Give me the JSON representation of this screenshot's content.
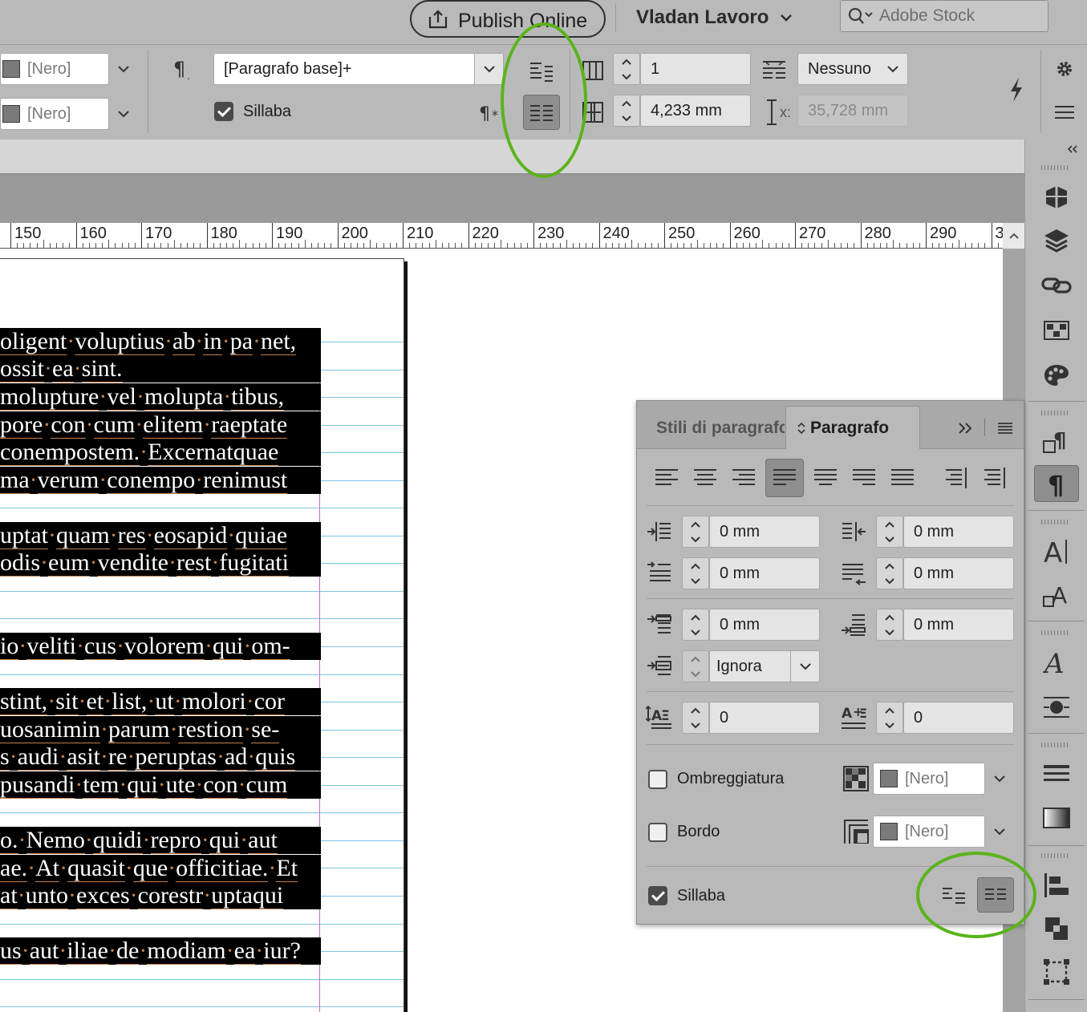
{
  "topbar": {
    "publish_label": "Publish Online",
    "workspace_label": "Vladan Lavoro",
    "search_placeholder": "Adobe Stock"
  },
  "control": {
    "fill_color": "[Nero]",
    "stroke_color": "[Nero]",
    "paragraph_style": "[Paragrafo base]+",
    "hyphenate_label": "Sillaba",
    "hyphenate_checked": true,
    "columns": "1",
    "gutter": "4,233 mm",
    "span_columns": "Nessuno",
    "x_label": "x:",
    "x_value": "35,728 mm"
  },
  "ruler": {
    "labels": [
      "150",
      "160",
      "170",
      "180",
      "190",
      "200",
      "210",
      "220",
      "230",
      "240",
      "250",
      "260",
      "270",
      "280",
      "290",
      "3"
    ]
  },
  "document": {
    "lines": [
      [
        "oligent voluptius ab in pa net,",
        433
      ],
      [
        "ossit ea sint.",
        467
      ],
      [
        "molupture vel molupta tibus,",
        502
      ],
      [
        "pore con cum elitem raeptate",
        537
      ],
      [
        "conempostem. Excernatquae",
        571
      ],
      [
        "ma verum conempo renimust",
        606
      ],
      [
        "uptat quam res eosapid quiae",
        675
      ],
      [
        "odis eum vendite rest fugitati",
        709
      ],
      [
        "io veliti cus volorem qui om-",
        813
      ],
      [
        "stint, sit et list, ut molori cor",
        882
      ],
      [
        "uosanimin parum restion se-",
        917
      ],
      [
        "s audi asit re peruptas ad quis",
        951
      ],
      [
        "pusandi tem qui ute con cum",
        986
      ],
      [
        "o. Nemo quidi repro qui aut",
        1055
      ],
      [
        "ae. At quasit que officitiae. Et",
        1090
      ],
      [
        "at unto exces corestr uptaqui",
        1124
      ],
      [
        "us aut iliae de modiam ea iur?",
        1193
      ]
    ]
  },
  "panel": {
    "tab_styles": "Stili di paragrafo",
    "tab_paragraph": "Paragrafo",
    "left_indent": "0 mm",
    "right_indent": "0 mm",
    "first_line_indent": "0 mm",
    "last_line_indent": "0 mm",
    "space_before": "0 mm",
    "space_after": "0 mm",
    "align_to_grid": "Ignora",
    "drop_cap_lines": "0",
    "drop_cap_chars": "0",
    "shading_label": "Ombreggiatura",
    "shading_color": "[Nero]",
    "border_label": "Bordo",
    "border_color": "[Nero]",
    "hyphenate_label": "Sillaba"
  },
  "colors": {
    "annotation": "#5bb31b",
    "ui_gray": "#b9b9b9",
    "text_highlight": "#000000"
  }
}
